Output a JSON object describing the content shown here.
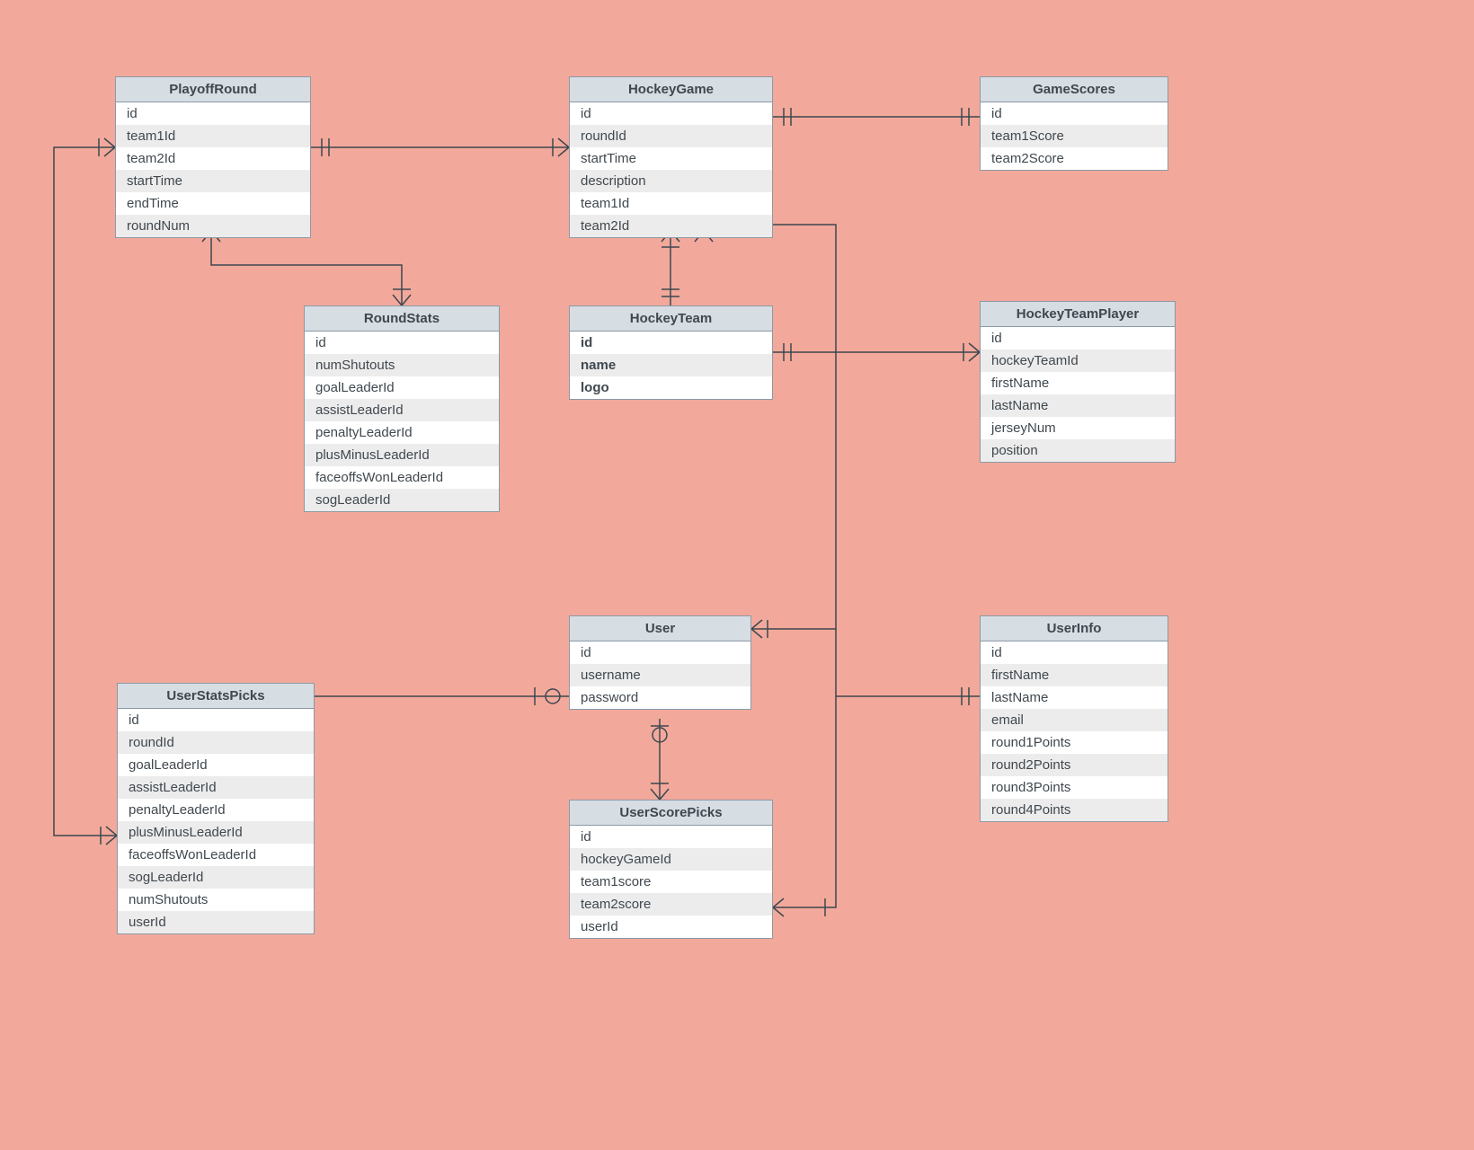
{
  "entities": {
    "playoffRound": {
      "title": "PlayoffRound",
      "fields": [
        "id",
        "team1Id",
        "team2Id",
        "startTime",
        "endTime",
        "roundNum"
      ],
      "bold": []
    },
    "hockeyGame": {
      "title": "HockeyGame",
      "fields": [
        "id",
        "roundId",
        "startTime",
        "description",
        "team1Id",
        "team2Id"
      ],
      "bold": []
    },
    "gameScores": {
      "title": "GameScores",
      "fields": [
        "id",
        "team1Score",
        "team2Score"
      ],
      "bold": []
    },
    "roundStats": {
      "title": "RoundStats",
      "fields": [
        "id",
        "numShutouts",
        "goalLeaderId",
        "assistLeaderId",
        "penaltyLeaderId",
        "plusMinusLeaderId",
        "faceoffsWonLeaderId",
        "sogLeaderId"
      ],
      "bold": []
    },
    "hockeyTeam": {
      "title": "HockeyTeam",
      "fields": [
        "id",
        "name",
        "logo"
      ],
      "bold": [
        0,
        1,
        2
      ]
    },
    "hockeyTeamPlayer": {
      "title": "HockeyTeamPlayer",
      "fields": [
        "id",
        "hockeyTeamId",
        "firstName",
        "lastName",
        "jerseyNum",
        "position"
      ],
      "bold": []
    },
    "user": {
      "title": "User",
      "fields": [
        "id",
        "username",
        "password"
      ],
      "bold": []
    },
    "userInfo": {
      "title": "UserInfo",
      "fields": [
        "id",
        "firstName",
        "lastName",
        "email",
        "round1Points",
        "round2Points",
        "round3Points",
        "round4Points"
      ],
      "bold": []
    },
    "userStatsPicks": {
      "title": "UserStatsPicks",
      "fields": [
        "id",
        "roundId",
        "goalLeaderId",
        "assistLeaderId",
        "penaltyLeaderId",
        "plusMinusLeaderId",
        "faceoffsWonLeaderId",
        "sogLeaderId",
        "numShutouts",
        "userId"
      ],
      "bold": []
    },
    "userScorePicks": {
      "title": "UserScorePicks",
      "fields": [
        "id",
        "hockeyGameId",
        "team1score",
        "team2score",
        "userId"
      ],
      "bold": []
    }
  }
}
